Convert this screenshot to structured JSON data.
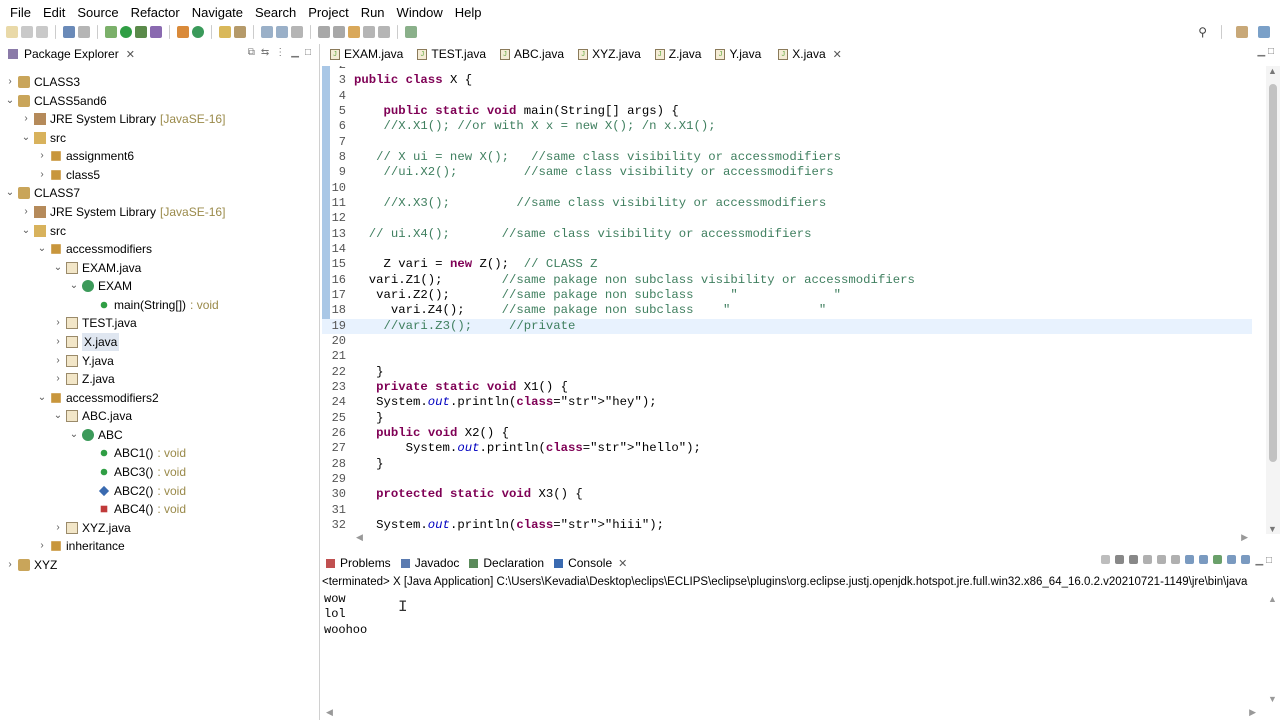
{
  "menu": [
    "File",
    "Edit",
    "Source",
    "Refactor",
    "Navigate",
    "Search",
    "Project",
    "Run",
    "Window",
    "Help"
  ],
  "package_explorer": {
    "title": "Package Explorer",
    "items": [
      {
        "label": "CLASS3",
        "suffix": ""
      },
      {
        "label": "CLASS5and6",
        "suffix": ""
      },
      {
        "label": "JRE System Library",
        "suffix": "[JavaSE-16]"
      },
      {
        "label": "src",
        "suffix": ""
      },
      {
        "label": "assignment6",
        "suffix": ""
      },
      {
        "label": "class5",
        "suffix": ""
      },
      {
        "label": "CLASS7",
        "suffix": ""
      },
      {
        "label": "JRE System Library",
        "suffix": "[JavaSE-16]"
      },
      {
        "label": "src",
        "suffix": ""
      },
      {
        "label": "accessmodifiers",
        "suffix": ""
      },
      {
        "label": "EXAM.java",
        "suffix": ""
      },
      {
        "label": "EXAM",
        "suffix": ""
      },
      {
        "label": "main(String[])",
        "suffix": ": void"
      },
      {
        "label": "TEST.java",
        "suffix": ""
      },
      {
        "label": "X.java",
        "suffix": ""
      },
      {
        "label": "Y.java",
        "suffix": ""
      },
      {
        "label": "Z.java",
        "suffix": ""
      },
      {
        "label": "accessmodifiers2",
        "suffix": ""
      },
      {
        "label": "ABC.java",
        "suffix": ""
      },
      {
        "label": "ABC",
        "suffix": ""
      },
      {
        "label": "ABC1()",
        "suffix": ": void"
      },
      {
        "label": "ABC3()",
        "suffix": ": void"
      },
      {
        "label": "ABC2()",
        "suffix": ": void"
      },
      {
        "label": "ABC4()",
        "suffix": ": void"
      },
      {
        "label": "XYZ.java",
        "suffix": ""
      },
      {
        "label": "inheritance",
        "suffix": ""
      },
      {
        "label": "XYZ",
        "suffix": ""
      }
    ]
  },
  "editor_tabs": [
    "EXAM.java",
    "TEST.java",
    "ABC.java",
    "XYZ.java",
    "Z.java",
    "Y.java",
    "X.java"
  ],
  "code_lines": [
    {
      "n": "2",
      "t": ""
    },
    {
      "n": "3",
      "t": "public class X {"
    },
    {
      "n": "4",
      "t": ""
    },
    {
      "n": "5",
      "t": "    public static void main(String[] args) {"
    },
    {
      "n": "6",
      "t": "    //X.X1(); //or with X x = new X(); /n x.X1();"
    },
    {
      "n": "7",
      "t": ""
    },
    {
      "n": "8",
      "t": "   // X ui = new X();   //same class visibility or accessmodifiers"
    },
    {
      "n": "9",
      "t": "    //ui.X2();         //same class visibility or accessmodifiers"
    },
    {
      "n": "10",
      "t": ""
    },
    {
      "n": "11",
      "t": "    //X.X3();         //same class visibility or accessmodifiers"
    },
    {
      "n": "12",
      "t": ""
    },
    {
      "n": "13",
      "t": "  // ui.X4();       //same class visibility or accessmodifiers"
    },
    {
      "n": "14",
      "t": ""
    },
    {
      "n": "15",
      "t": "    Z vari = new Z();  // CLASS Z"
    },
    {
      "n": "16",
      "t": "  vari.Z1();        //same pakage non subclass visibility or accessmodifiers"
    },
    {
      "n": "17",
      "t": "   vari.Z2();       //same pakage non subclass     \"             \""
    },
    {
      "n": "18",
      "t": "     vari.Z4();     //same pakage non subclass    \"            \""
    },
    {
      "n": "19",
      "t": "    //vari.Z3();     //private"
    },
    {
      "n": "20",
      "t": ""
    },
    {
      "n": "21",
      "t": ""
    },
    {
      "n": "22",
      "t": "   }"
    },
    {
      "n": "23",
      "t": "   private static void X1() {"
    },
    {
      "n": "24",
      "t": "   System.out.println(\"hey\");"
    },
    {
      "n": "25",
      "t": "   }"
    },
    {
      "n": "26",
      "t": "   public void X2() {"
    },
    {
      "n": "27",
      "t": "       System.out.println(\"hello\");"
    },
    {
      "n": "28",
      "t": "   }"
    },
    {
      "n": "29",
      "t": ""
    },
    {
      "n": "30",
      "t": "   protected static void X3() {"
    },
    {
      "n": "31",
      "t": ""
    },
    {
      "n": "32",
      "t": "   System.out.println(\"hiii\");"
    }
  ],
  "console_tabs": [
    "Problems",
    "Javadoc",
    "Declaration",
    "Console"
  ],
  "console_status": "<terminated> X [Java Application] C:\\Users\\Kevadia\\Desktop\\eclips\\ECLIPS\\eclipse\\plugins\\org.eclipse.justj.openjdk.hotspot.jre.full.win32.x86_64_16.0.2.v20210721-1149\\jre\\bin\\java",
  "console_output": [
    "wow",
    "lol",
    "woohoo"
  ]
}
